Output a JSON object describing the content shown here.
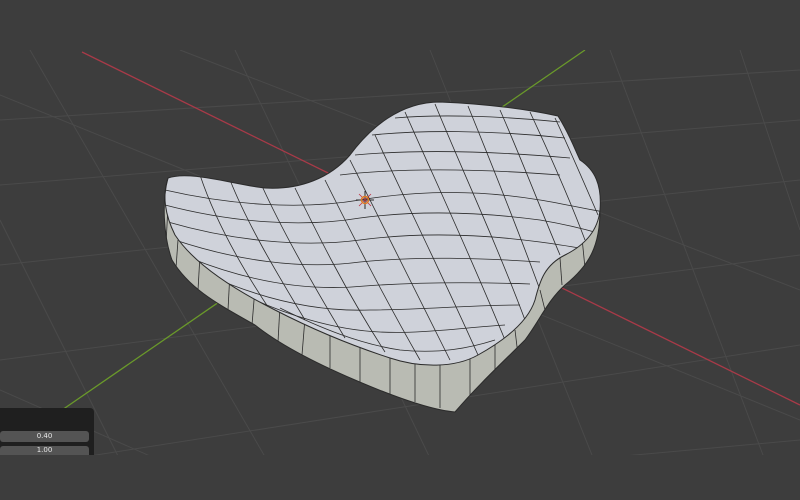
{
  "viewport": {
    "colors": {
      "background": "#3d3d3d",
      "grid": "#4a4a4a",
      "x_axis": "#a83a48",
      "y_axis": "#6a9a2a",
      "mesh_face": "#c9ccd3",
      "mesh_edge": "#2b2b2b",
      "origin_marker": "#e07a20"
    },
    "icons": [
      "origin-cursor-icon"
    ]
  },
  "operator_panel": {
    "field_1_value": "0.40",
    "field_2_value": "1.00"
  }
}
